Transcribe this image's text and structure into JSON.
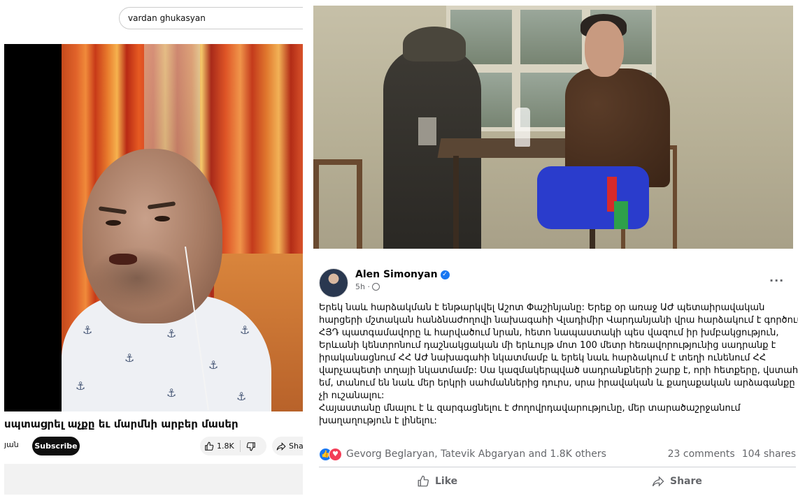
{
  "youtube": {
    "search_value": "vardan ghukasyan",
    "video_title": "սպտացրել աչքը եւ մարմնի արբեր մասեր",
    "channel_fragment": "յան",
    "subscribe_label": "Subscribe",
    "like_count": "1.8K",
    "share_label": "Sha"
  },
  "facebook": {
    "author_name": "Alen Simonyan",
    "post_time": "5h ·",
    "more_label": "···",
    "post_lines": [
      "Երեկ նաև հարձակման է ենթարկվել Աշոտ Փաշինյանը: Երեք օր առաջ ԱԺ պետաիրավական",
      "հարցերի մշտական հանձնաժողովի նախագահի Վլադիմիր Վարդանյանի վրա հարձակում է գործում",
      "ՀՅԴ պատգամավորը և հարվածում նրան, հետո նապաստակի պես վազում իր խմբակցություն,",
      "Երևանի կենտրոնում դաշնակցական մի երևույթ մոտ 100 մետր հեռավորությունից սադրանք է",
      "իրականացնում ՀՀ ԱԺ նախագահի նկատմամբ և երեկ նաև հարձակում է տեղի ունենում ՀՀ",
      "վարչապետի տղայի նկատմամբ: Սա կազմակերպված սադրանքների շարք է, որի հետքերը, վստահ",
      "եմ, տանում են նաև մեր երկրի սահմաններից դուրս, սրա իրավական և քաղաքական արձագանքը",
      "չի ուշանալու:",
      "Հայաստանը մնալու է և զարգացնելու է ժողովրդավարությունը, մեր տարածաշրջանում",
      "խաղաղություն է լինելու:"
    ],
    "reactors": "Gevorg Beglaryan, Tatevik Abgaryan and 1.8K others",
    "comments": "23 comments",
    "shares": "104 shares",
    "like_label": "Like",
    "share_label": "Share"
  }
}
